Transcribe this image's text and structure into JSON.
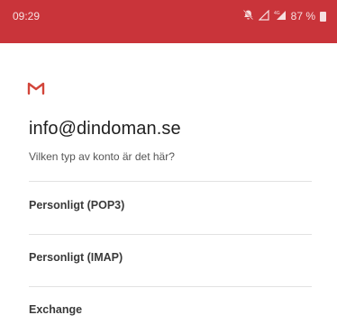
{
  "status_bar": {
    "time": "09:29",
    "battery": "87 %",
    "icons": [
      "mute-icon",
      "signal-icon",
      "network-icon",
      "battery-icon"
    ]
  },
  "app": {
    "icon": "gmail-icon",
    "accent_color": "#c9343a"
  },
  "account": {
    "email": "info@dindoman.se",
    "question": "Vilken typ av konto är det här?"
  },
  "options": [
    {
      "label": "Personligt (POP3)"
    },
    {
      "label": "Personligt (IMAP)"
    },
    {
      "label": "Exchange"
    }
  ]
}
